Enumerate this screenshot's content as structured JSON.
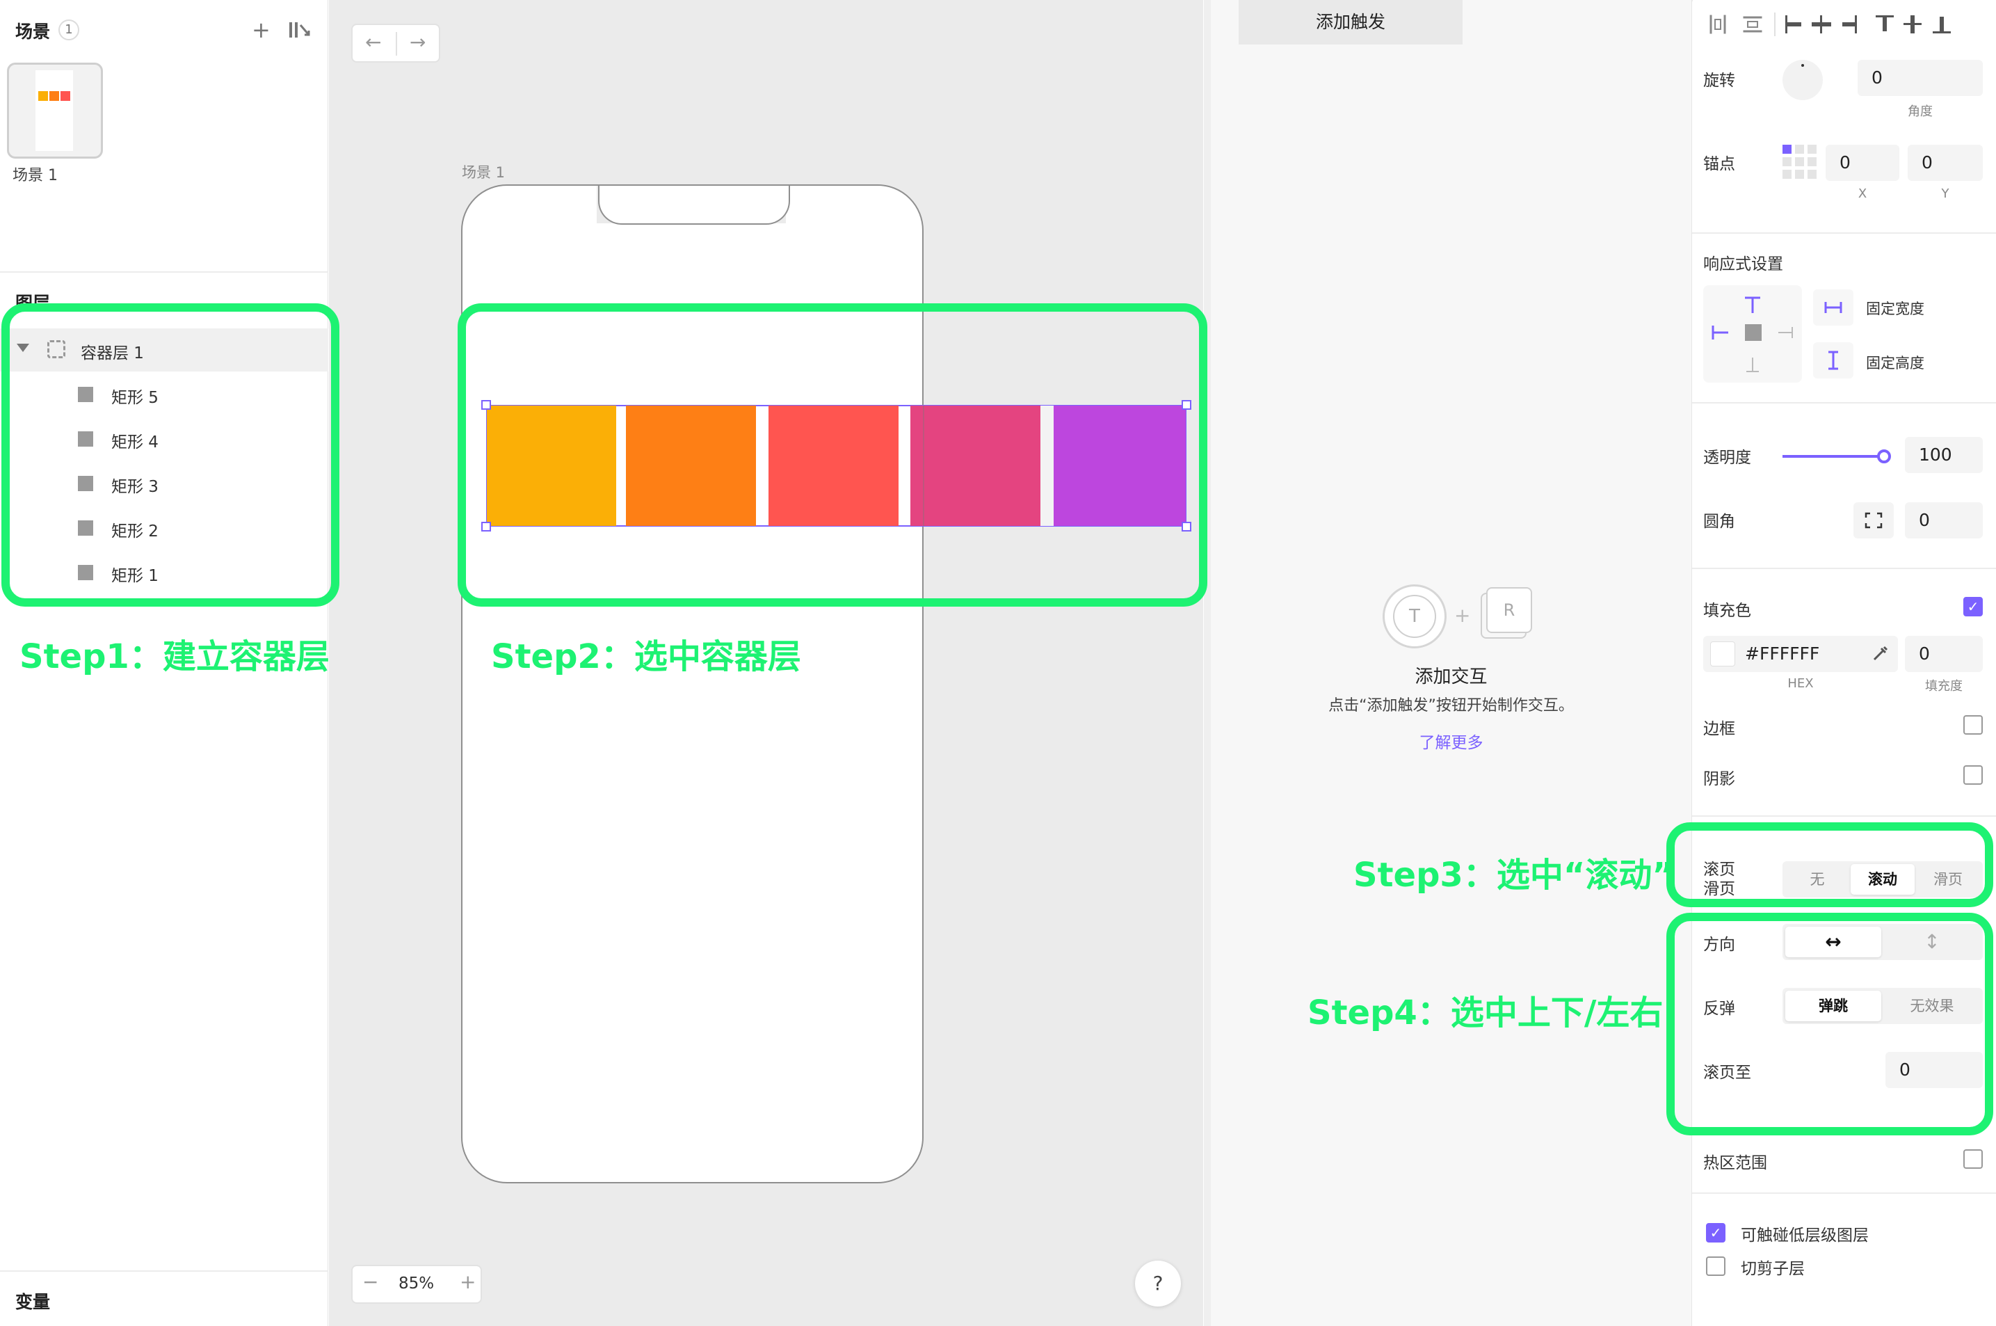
{
  "scenes": {
    "title": "场景",
    "count": "1",
    "thumb_label": "场景 1"
  },
  "layers": {
    "title": "图层",
    "container": "容器层 1",
    "items": [
      "矩形 5",
      "矩形 4",
      "矩形 3",
      "矩形 2",
      "矩形 1"
    ]
  },
  "variables": {
    "title": "变量"
  },
  "canvas": {
    "artboard_label": "场景 1",
    "zoom": "85%",
    "zoom_minus": "−",
    "zoom_plus": "+",
    "help": "?",
    "rect_colors": [
      "#FBAF06",
      "#FE7F15",
      "#FF5550",
      "#E44480",
      "#BD46DE"
    ]
  },
  "interaction": {
    "tab": "添加触发",
    "badge_t": "T",
    "badge_r": "R",
    "badge_plus": "+",
    "empty_title": "添加交互",
    "empty_desc": "点击“添加触发”按钮开始制作交互。",
    "learn_more": "了解更多"
  },
  "props": {
    "rotation_label": "旋转",
    "rotation_value": "0",
    "rotation_unit": "角度",
    "anchor_label": "锚点",
    "anchor_x": "0",
    "anchor_y": "0",
    "x_label": "X",
    "y_label": "Y",
    "responsive_label": "响应式设置",
    "fixed_width": "固定宽度",
    "fixed_height": "固定高度",
    "opacity_label": "透明度",
    "opacity_value": "100",
    "opacity_level": 1.0,
    "radius_label": "圆角",
    "radius_value": "0",
    "fill_label": "填充色",
    "fill_hex": "#FFFFFF",
    "fill_amount": "0",
    "hex_caption": "HEX",
    "fill_caption": "填充度",
    "border_label": "边框",
    "shadow_label": "阴影",
    "scroll_label_1": "滚页",
    "scroll_label_2": "滑页",
    "scroll_options": [
      "无",
      "滚动",
      "滑页"
    ],
    "direction_label": "方向",
    "direction_h": "↔",
    "direction_v": "↕",
    "bounce_label": "反弹",
    "bounce_options": [
      "弹跳",
      "无效果"
    ],
    "scroll_to_label": "滚页至",
    "scroll_to_value": "0",
    "hotzone_label": "热区范围",
    "touch_lower_label": "可触碰低层级图层",
    "clip_children_label": "切剪子层"
  },
  "annotations": {
    "step1": "Step1：建立容器层",
    "step2": "Step2：选中容器层",
    "step3": "Step3：选中“滚动”",
    "step4": "Step4：选中上下/左右"
  },
  "colors": {
    "accent": "#7B61FF",
    "annotation_green": "#1DF272"
  }
}
